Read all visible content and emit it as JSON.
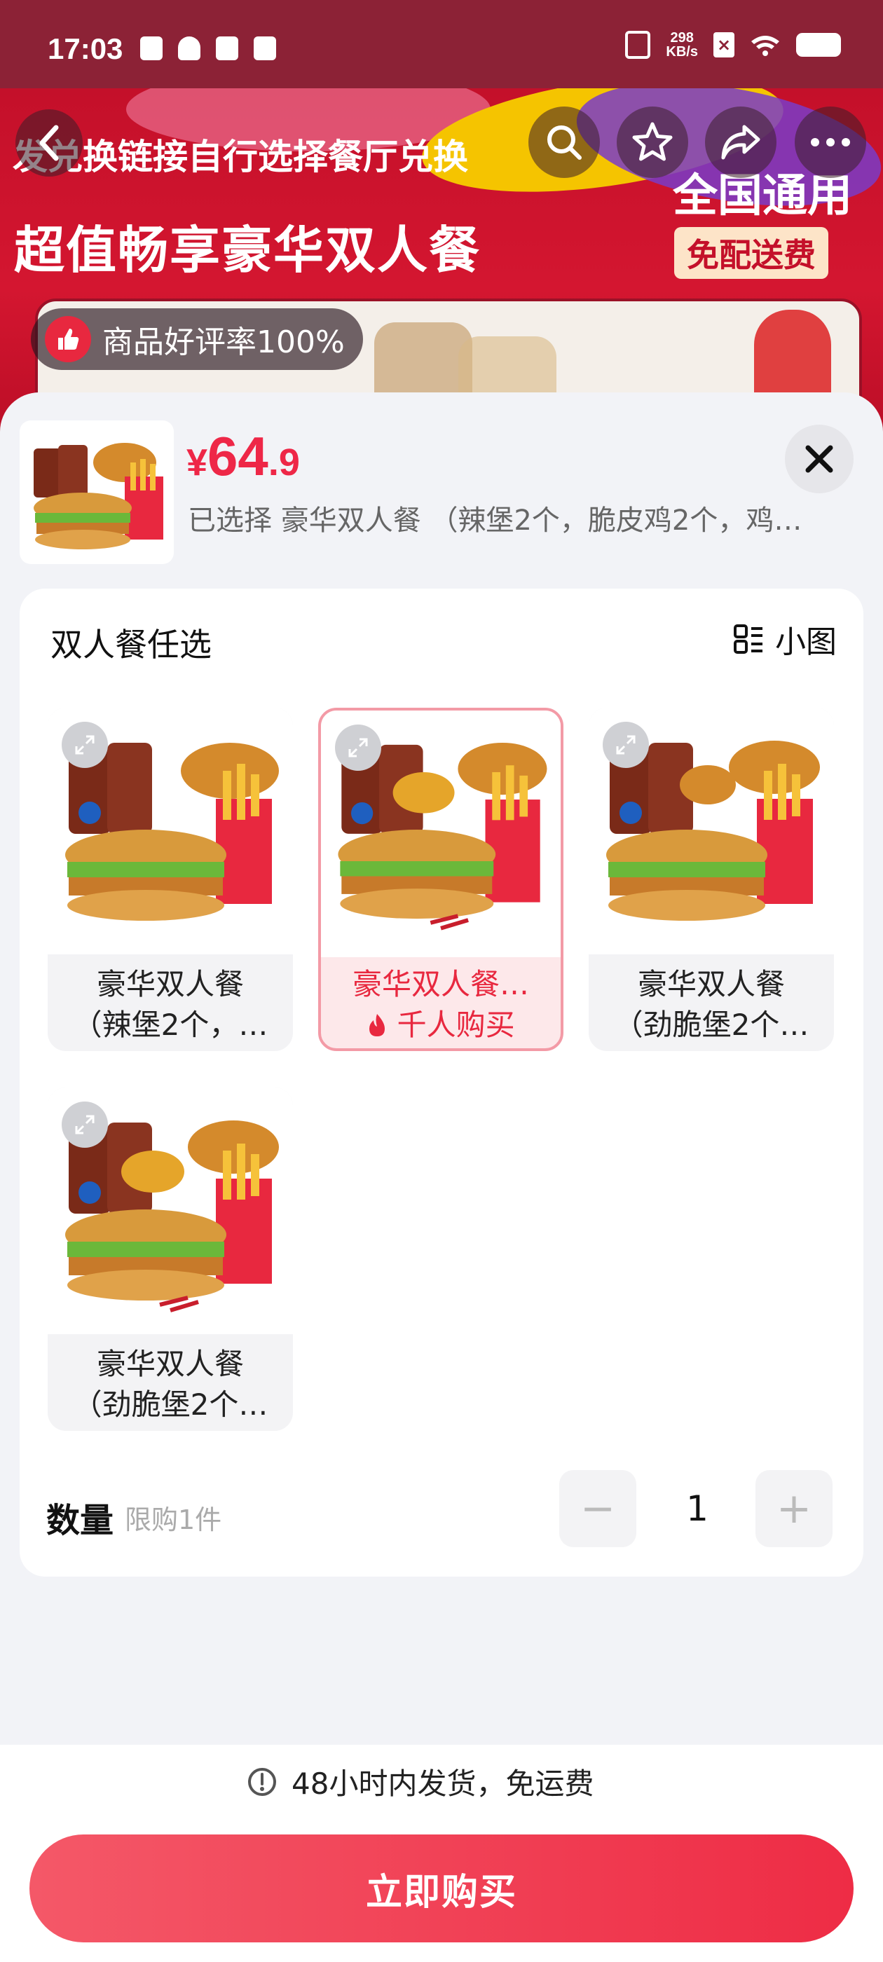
{
  "status_bar": {
    "time": "17:03",
    "net_speed_value": "298",
    "net_speed_unit": "KB/s"
  },
  "banner": {
    "line1": "发兑换链接自行选择餐厅兑换",
    "line2": "超值畅享豪华双人餐",
    "national": "全国通用",
    "no_delivery": "免配送费",
    "rating": "商品好评率100%"
  },
  "nav": {
    "back": "back-icon",
    "search": "search-icon",
    "favorite": "star-icon",
    "share": "share-icon",
    "more": "more-icon"
  },
  "product": {
    "price_currency": "¥",
    "price_int": "64",
    "price_dec": ".9",
    "selected_prefix": "已选择",
    "selected_name": "豪华双人餐",
    "selected_tag1": "（辣堡2个，",
    "selected_tag2": "脆皮鸡2个，",
    "selected_tag3": "鸡…"
  },
  "options_card": {
    "title": "双人餐任选",
    "view_toggle_label": "小图",
    "options": [
      {
        "line1": "豪华双人餐",
        "line2": "（辣堡2个，…",
        "selected": false
      },
      {
        "line1": "豪华双人餐…",
        "line2": "千人购买",
        "selected": true
      },
      {
        "line1": "豪华双人餐",
        "line2": "（劲脆堡2个…",
        "selected": false
      },
      {
        "line1": "豪华双人餐",
        "line2": "（劲脆堡2个…",
        "selected": false
      }
    ]
  },
  "quantity": {
    "label": "数量",
    "limit": "限购1件",
    "value": "1",
    "minus": "−",
    "plus": "+"
  },
  "bottom": {
    "ship_text": "48小时内发货",
    "ship_suffix": "，免运费",
    "buy_label": "立即购买"
  },
  "colors": {
    "accent": "#ee2747",
    "buy_start": "#f45868",
    "buy_end": "#ee2c45"
  }
}
